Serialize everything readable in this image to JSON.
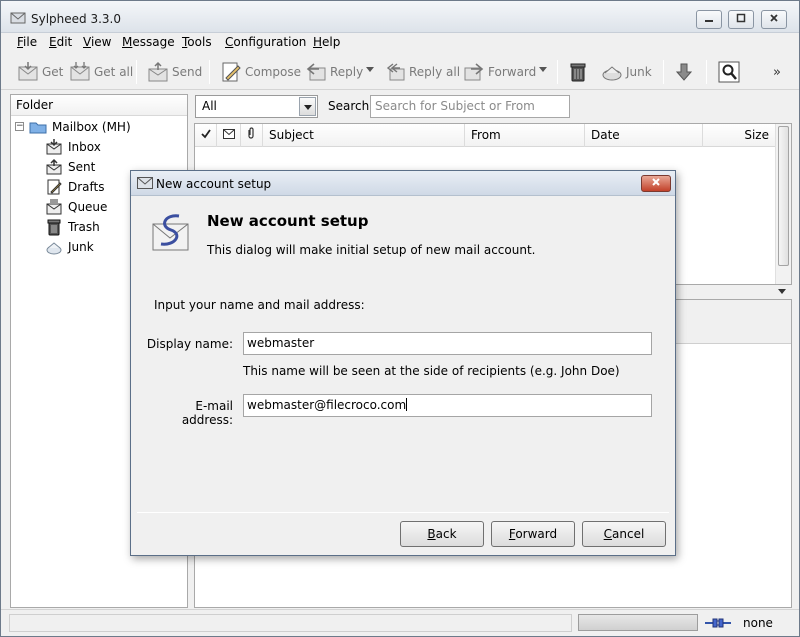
{
  "window": {
    "title": "Sylpheed 3.3.0"
  },
  "menu": [
    {
      "label": "File",
      "u": "F",
      "rest": "ile"
    },
    {
      "label": "Edit",
      "u": "E",
      "rest": "dit"
    },
    {
      "label": "View",
      "u": "V",
      "rest": "iew"
    },
    {
      "label": "Message",
      "u": "M",
      "rest": "essage"
    },
    {
      "label": "Tools",
      "u": "T",
      "rest": "ools"
    },
    {
      "label": "Configuration",
      "u": "C",
      "rest": "onfiguration"
    },
    {
      "label": "Help",
      "u": "H",
      "rest": "elp"
    }
  ],
  "toolbar": {
    "get": "Get",
    "get_all": "Get all",
    "send": "Send",
    "compose": "Compose",
    "reply": "Reply",
    "reply_all": "Reply all",
    "forward": "Forward",
    "junk": "Junk",
    "more": "»"
  },
  "folders": {
    "header": "Folder",
    "root": "Mailbox (MH)",
    "items": [
      "Inbox",
      "Sent",
      "Drafts",
      "Queue",
      "Trash",
      "Junk"
    ]
  },
  "filter": {
    "selected": "All"
  },
  "search": {
    "label": "Search:",
    "placeholder": "Search for Subject or From"
  },
  "columns": {
    "subject": "Subject",
    "from": "From",
    "date": "Date",
    "size": "Size"
  },
  "status": {
    "text": "none"
  },
  "dialog": {
    "title": "New account setup",
    "heading": "New account setup",
    "description": "This dialog will make initial setup of new mail account.",
    "prompt": "Input your name and mail address:",
    "display_name_label": "Display name:",
    "display_name_value": "webmaster",
    "hint": "This name will be seen at the side of recipients (e.g. John Doe)",
    "email_label": "E-mail address:",
    "email_value": "webmaster@filecroco.com",
    "back": {
      "u": "B",
      "rest": "ack"
    },
    "forward": {
      "u": "F",
      "rest": "orward"
    },
    "cancel": {
      "u": "C",
      "rest": "ancel"
    }
  }
}
